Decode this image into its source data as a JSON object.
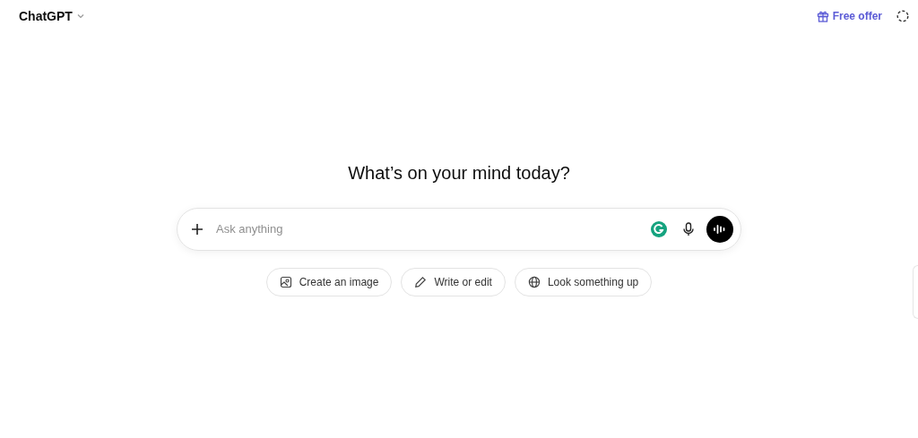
{
  "header": {
    "model_name": "ChatGPT",
    "offer": "Free offer"
  },
  "heading": "What’s on your mind today?",
  "composer": {
    "placeholder": "Ask anything"
  },
  "suggestions": [
    {
      "kind": "image",
      "label": "Create an image"
    },
    {
      "kind": "edit",
      "label": "Write or edit"
    },
    {
      "kind": "search",
      "label": "Look something up"
    }
  ]
}
